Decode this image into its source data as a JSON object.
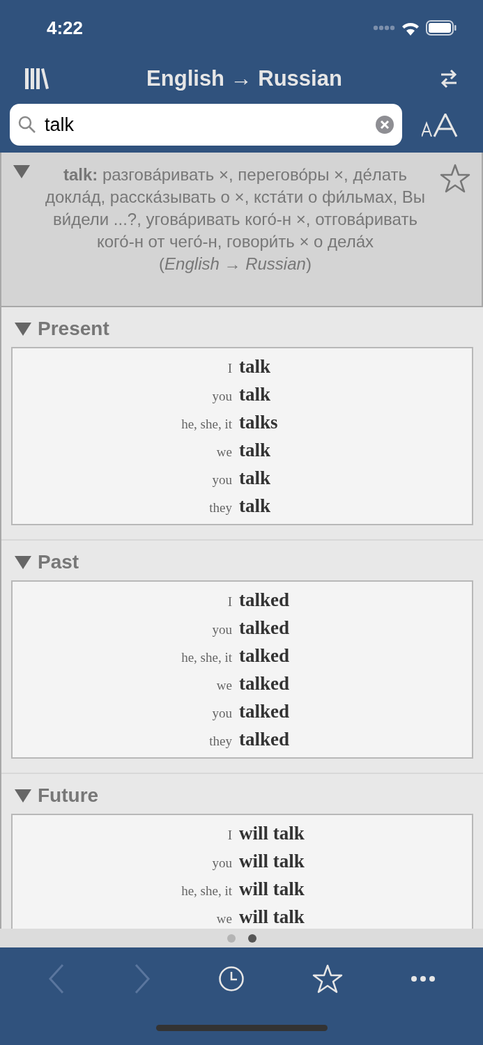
{
  "status_bar": {
    "time": "4:22"
  },
  "nav": {
    "title": "English → Russian"
  },
  "search": {
    "value": "talk"
  },
  "entry": {
    "expanded": true,
    "starred": false,
    "text": "**talk:** разгова́ривать ×, перегово́ры ×, де́лать  докла́д, расска́зывать  о ×, кста́ти о фи́льмах, Вы ви́дели ...?, угова́ривать кого́-н ×, отгова́ривать  кого́-н от чего́-н, говори́ть × о дела́х",
    "source": "(*English → Russian*)"
  },
  "sections": [
    {
      "title": "Present",
      "expanded": true,
      "rows": [
        {
          "pronoun": "I",
          "form": "talk"
        },
        {
          "pronoun": "you",
          "form": "talk"
        },
        {
          "pronoun": "he, she, it",
          "form": "talks"
        },
        {
          "pronoun": "we",
          "form": "talk"
        },
        {
          "pronoun": "you",
          "form": "talk"
        },
        {
          "pronoun": "they",
          "form": "talk"
        }
      ]
    },
    {
      "title": "Past",
      "expanded": true,
      "rows": [
        {
          "pronoun": "I",
          "form": "talked"
        },
        {
          "pronoun": "you",
          "form": "talked"
        },
        {
          "pronoun": "he, she, it",
          "form": "talked"
        },
        {
          "pronoun": "we",
          "form": "talked"
        },
        {
          "pronoun": "you",
          "form": "talked"
        },
        {
          "pronoun": "they",
          "form": "talked"
        }
      ]
    },
    {
      "title": "Future",
      "expanded": true,
      "rows": [
        {
          "pronoun": "I",
          "form": "will talk"
        },
        {
          "pronoun": "you",
          "form": "will talk"
        },
        {
          "pronoun": "he, she, it",
          "form": "will talk"
        },
        {
          "pronoun": "we",
          "form": "will talk"
        }
      ]
    }
  ],
  "pages": [
    {
      "selected": false
    },
    {
      "selected": true
    }
  ],
  "toolbar": [
    {
      "kind": "back",
      "disabled": true
    },
    {
      "kind": "forward",
      "disabled": true
    },
    {
      "kind": "history",
      "disabled": false
    },
    {
      "kind": "favorites",
      "disabled": false
    },
    {
      "kind": "more",
      "disabled": false
    }
  ]
}
